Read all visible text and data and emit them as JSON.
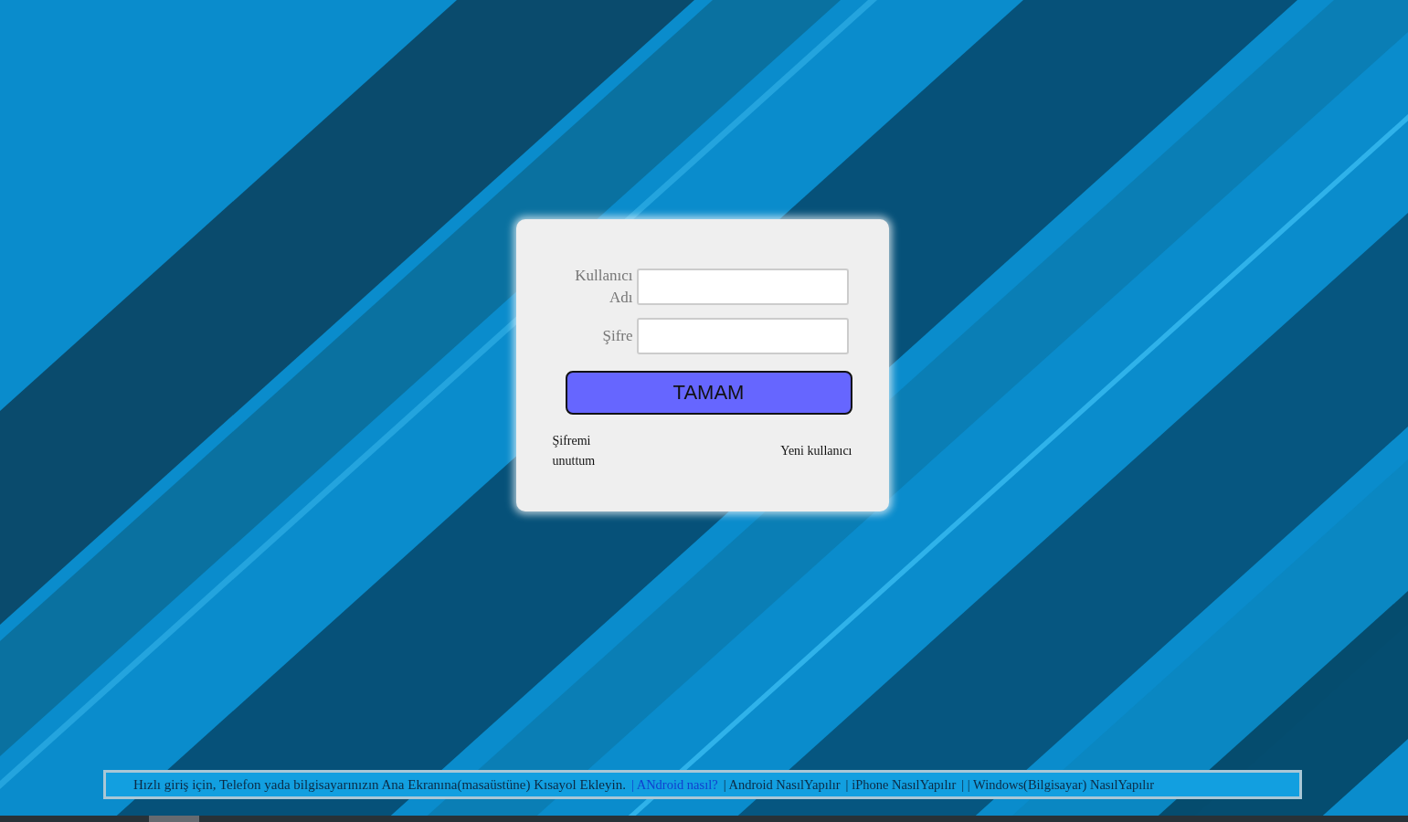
{
  "login": {
    "fields": [
      {
        "label": "Kullanıcı Adı"
      },
      {
        "label": "Şifre"
      }
    ],
    "submit": "TAMAM",
    "forgot": "Şifremi unuttum",
    "register": "Yeni kullanıcı"
  },
  "footer": {
    "text": "Hızlı giriş için, Telefon yada bilgisayarınızın Ana Ekranına(masaüstüne) Kısayol Ekleyin.",
    "links": [
      {
        "label": "| ANdroid nasıl?",
        "kind": "highlight"
      },
      {
        "label": "| Android NasılYapılır",
        "kind": "plain"
      },
      {
        "label": "| iPhone NasılYapılır",
        "kind": "plain"
      },
      {
        "label": "| | Windows(Bilgisayar) NasılYapılır",
        "kind": "plain"
      }
    ]
  }
}
